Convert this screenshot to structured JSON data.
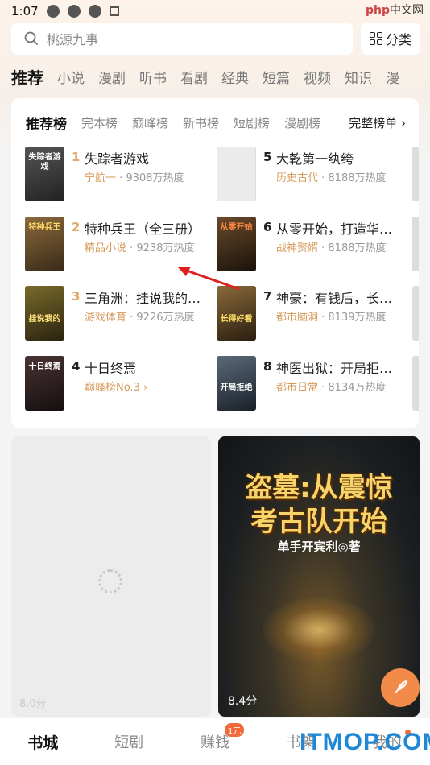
{
  "status_bar": {
    "time": "1:07"
  },
  "watermark_top": {
    "brand": "php",
    "text": "中文网"
  },
  "search": {
    "placeholder": "桃源九事"
  },
  "category_button": {
    "label": "分类"
  },
  "top_tabs": [
    "推荐",
    "小说",
    "漫剧",
    "听书",
    "看剧",
    "经典",
    "短篇",
    "视频",
    "知识",
    "漫"
  ],
  "rank": {
    "tabs": [
      "推荐榜",
      "完本榜",
      "巅峰榜",
      "新书榜",
      "短剧榜",
      "漫剧榜"
    ],
    "full_label": "完整榜单 ›",
    "books": [
      {
        "num": "1",
        "title": "失踪者游戏",
        "tag": "宁航一",
        "heat": " · 9308万热度",
        "cover_text": "失踪者游戏",
        "cover_color": "#3a3a3a"
      },
      {
        "num": "2",
        "title": "特种兵王（全三册）",
        "tag": "精品小说",
        "heat": " · 9238万热度",
        "cover_text": "特种兵王",
        "cover_color": "#6b4a2c"
      },
      {
        "num": "3",
        "title": "三角洲：挂说我的…",
        "tag": "游戏体育",
        "heat": " · 9226万热度",
        "cover_text": "挂说我的",
        "cover_color": "#3d3a1c"
      },
      {
        "num": "4",
        "title": "十日终焉",
        "tag": "巅峰榜No.3 ›",
        "heat": "",
        "cover_text": "十日终焉",
        "cover_color": "#2a2222"
      },
      {
        "num": "5",
        "title": "大乾第一纨绔",
        "tag": "历史古代",
        "heat": " · 8188万热度",
        "cover_text": "",
        "cover_color": "#e9e9e9"
      },
      {
        "num": "6",
        "title": "从零开始，打造华…",
        "tag": "战神赘婿",
        "heat": " · 8188万热度",
        "cover_text": "从零开始",
        "cover_color": "#3a2a1a"
      },
      {
        "num": "7",
        "title": "神豪：有钱后，长…",
        "tag": "都市脑洞",
        "heat": " · 8139万热度",
        "cover_text": "长得好看",
        "cover_color": "#4a3a2a"
      },
      {
        "num": "8",
        "title": "神医出狱：开局拒…",
        "tag": "都市日常",
        "heat": " · 8134万热度",
        "cover_text": "开局拒绝",
        "cover_color": "#2c3440"
      }
    ]
  },
  "feed": {
    "left_score": "8.0分",
    "right_score": "8.4分",
    "poster_line1": "盗墓:从震惊",
    "poster_line2": "考古队开始",
    "poster_author": "单手开宾利◎著"
  },
  "bottom_nav": [
    {
      "label": "书城",
      "badge": ""
    },
    {
      "label": "短剧",
      "badge": ""
    },
    {
      "label": "赚钱",
      "badge": "1元"
    },
    {
      "label": "书架",
      "badge": ""
    },
    {
      "label": "我的",
      "badge": ""
    }
  ],
  "watermark_bottom": "ITMOP.COM",
  "colors": {
    "accent": "#f06a3c",
    "gold": "#e2a96a",
    "tag": "#d79a5c"
  }
}
